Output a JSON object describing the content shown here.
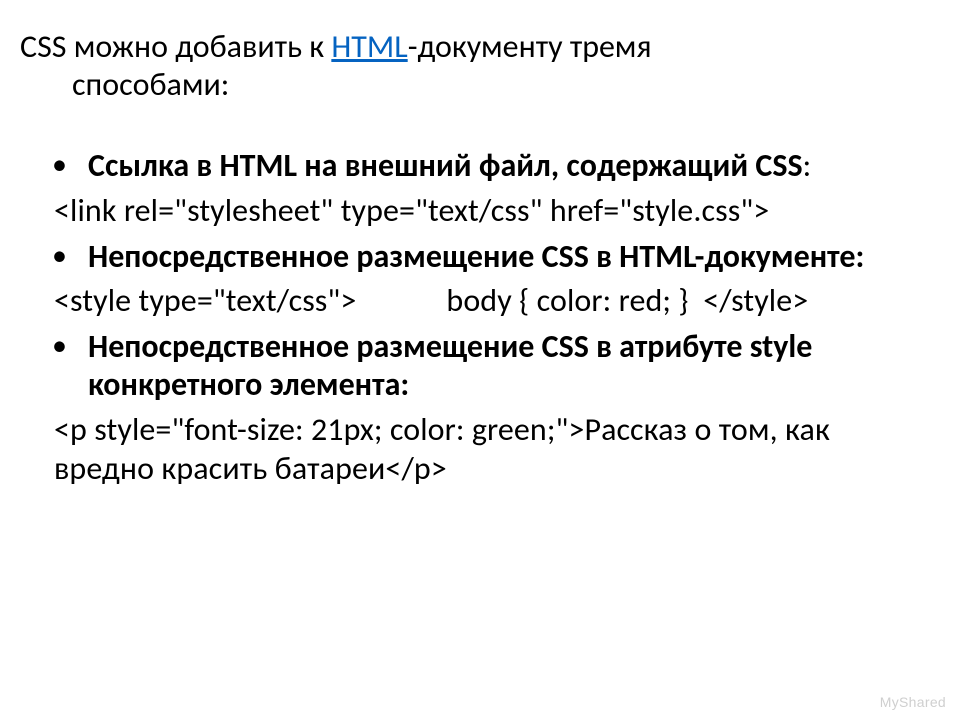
{
  "intro": {
    "prefix": "CSS можно добавить к ",
    "link": "HTML",
    "after_link": "-документу тремя",
    "line2": "способами:"
  },
  "bullets": [
    {
      "bold_head": " Ссылка в HTML на внешний файл, содержащий CSS",
      "bold_tail": ":",
      "code": "<link rel=\"stylesheet\" type=\"text/css\" href=\"style.css\">"
    },
    {
      "bold_head": "Непосредственное размещение CSS в HTML-документе:",
      "bold_tail": "",
      "code_parts": {
        "open": "<style type=\"text/css\">",
        "body": "body { color: red; }",
        "close": "</style>"
      }
    },
    {
      "bold_head": " Непосредственное размещение CSS в атрибуте style конкретного элемента:",
      "bold_tail": "",
      "code": "<p style=\"font-size: 21px; color: green;\">Рассказ о том, как вредно красить батареи</p>"
    }
  ],
  "watermark": "MyShared"
}
